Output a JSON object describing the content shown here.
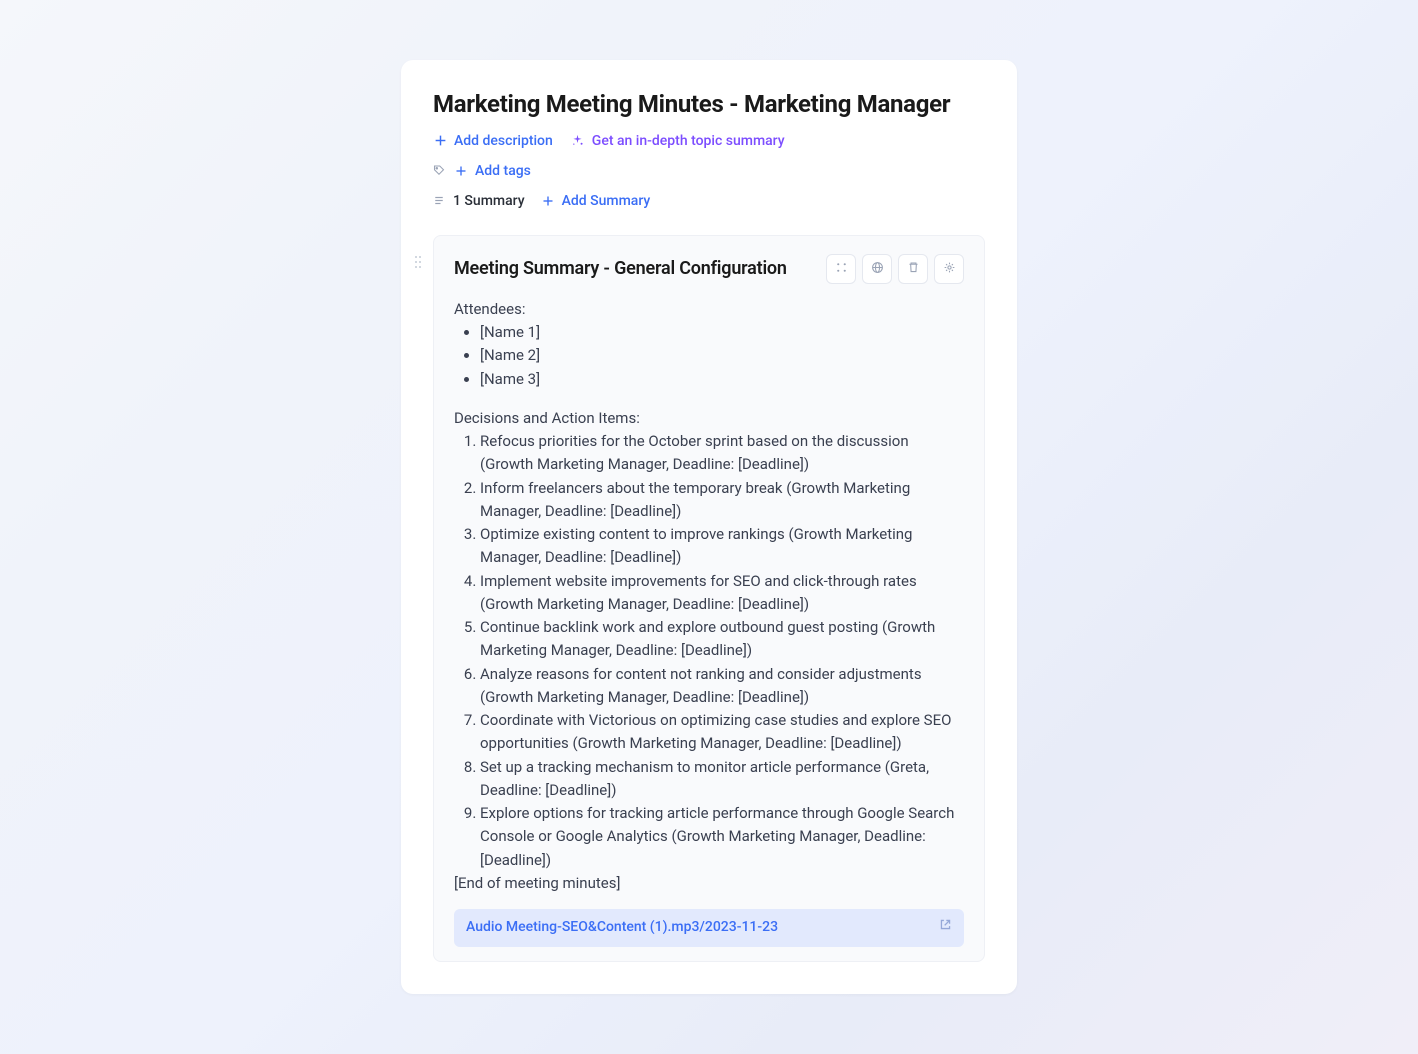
{
  "page": {
    "title": "Marketing Meeting Minutes - Marketing Manager"
  },
  "actions": {
    "add_description": "Add description",
    "get_summary": "Get an in-depth topic summary",
    "add_tags": "Add tags",
    "summary_count": "1 Summary",
    "add_summary": "Add Summary"
  },
  "summary": {
    "title": "Meeting Summary - General Configuration",
    "attendees_label": "Attendees:",
    "attendees": [
      "[Name 1]",
      "[Name 2]",
      "[Name 3]"
    ],
    "decisions_label": "Decisions and Action Items:",
    "decisions": [
      "Refocus priorities for the October sprint based on the discussion (Growth Marketing Manager, Deadline: [Deadline])",
      "Inform freelancers about the temporary break (Growth Marketing Manager, Deadline: [Deadline])",
      "Optimize existing content to improve rankings (Growth Marketing Manager, Deadline: [Deadline])",
      "Implement website improvements for SEO and click-through rates (Growth Marketing Manager, Deadline: [Deadline])",
      "Continue backlink work and explore outbound guest posting (Growth Marketing Manager, Deadline: [Deadline])",
      "Analyze reasons for content not ranking and consider adjustments (Growth Marketing Manager, Deadline: [Deadline])",
      "Coordinate with Victorious on optimizing case studies and explore SEO opportunities (Growth Marketing Manager, Deadline: [Deadline])",
      "Set up a tracking mechanism to monitor article performance (Greta, Deadline: [Deadline])",
      "Explore options for tracking article performance through Google Search Console or Google Analytics (Growth Marketing Manager, Deadline: [Deadline])"
    ],
    "end_note": "[End of meeting minutes]",
    "audio_file": "Audio Meeting-SEO&Content (1).mp3/2023-11-23"
  }
}
